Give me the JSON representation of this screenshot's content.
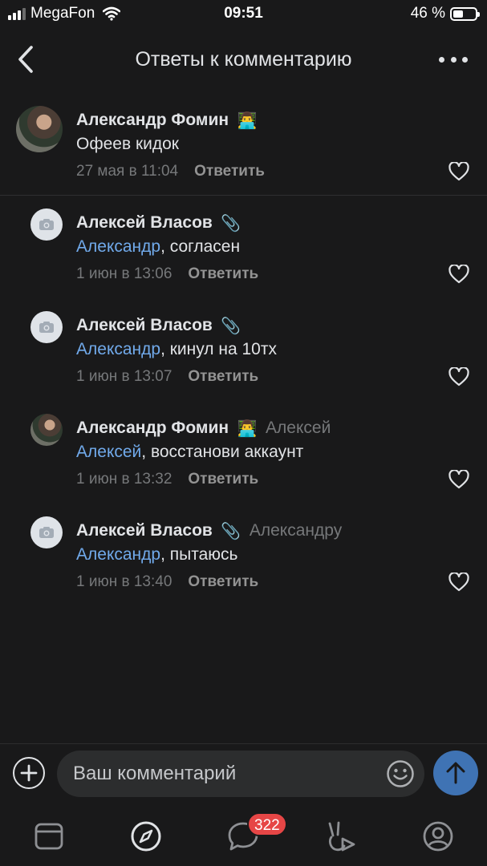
{
  "status_bar": {
    "carrier": "MegaFon",
    "time": "09:51",
    "battery": "46 %",
    "battery_level": 0.46
  },
  "header": {
    "title": "Ответы к комментарию",
    "back_icon": "chevron-left-icon",
    "more_icon": "more-dots-icon"
  },
  "comments": [
    {
      "author": "Александр Фомин",
      "emoji": "👨‍💻",
      "reply_to": "",
      "link": "",
      "text": "Офеев кидок",
      "date": "27 мая в 11:04",
      "reply_label": "Ответить"
    },
    {
      "author": "Алексей Власов",
      "emoji": "📎",
      "reply_to": "",
      "link": "Александр",
      "text": ", согласен",
      "date": "1 июн в 13:06",
      "reply_label": "Ответить"
    },
    {
      "author": "Алексей Власов",
      "emoji": "📎",
      "reply_to": "",
      "link": "Александр",
      "text": ", кинул на 10тх",
      "date": "1 июн в 13:07",
      "reply_label": "Ответить"
    },
    {
      "author": "Александр Фомин",
      "emoji": "👨‍💻",
      "reply_to": "Алексей",
      "link": "Алексей",
      "text": ", восстанови аккаунт",
      "date": "1 июн в 13:32",
      "reply_label": "Ответить"
    },
    {
      "author": "Алексей Власов",
      "emoji": "📎",
      "reply_to": "Александру",
      "link": "Александр",
      "text": ", пытаюсь",
      "date": "1 июн в 13:40",
      "reply_label": "Ответить"
    }
  ],
  "input": {
    "placeholder": "Ваш комментарий"
  },
  "tabbar": {
    "messages_badge": "322",
    "tabs": [
      "newsfeed-icon",
      "discover-icon",
      "messages-icon",
      "clips-icon",
      "profile-icon"
    ]
  },
  "colors": {
    "background": "#19191a",
    "link": "#71aaeb",
    "accent": "#3f73b4",
    "badge": "#e64646"
  }
}
